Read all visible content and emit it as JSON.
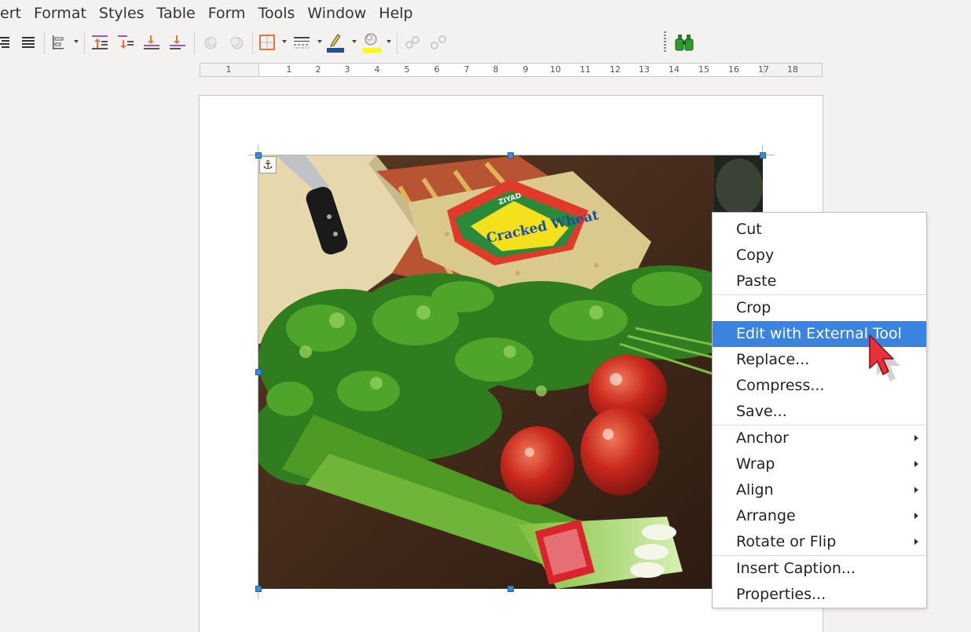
{
  "menubar": {
    "items": [
      "ert",
      "Format",
      "Styles",
      "Table",
      "Form",
      "Tools",
      "Window",
      "Help"
    ]
  },
  "ruler": {
    "numbers": [
      "1",
      "1",
      "2",
      "3",
      "4",
      "5",
      "6",
      "7",
      "8",
      "9",
      "10",
      "11",
      "12",
      "13",
      "14",
      "15",
      "16",
      "17",
      "18"
    ]
  },
  "context_menu": {
    "groups": [
      [
        {
          "label": "Cut"
        },
        {
          "label": "Copy"
        },
        {
          "label": "Paste"
        }
      ],
      [
        {
          "label": "Crop"
        },
        {
          "label": "Edit with External Tool",
          "active": true
        },
        {
          "label": "Replace..."
        },
        {
          "label": "Compress..."
        },
        {
          "label": "Save..."
        }
      ],
      [
        {
          "label": "Anchor",
          "submenu": true
        },
        {
          "label": "Wrap",
          "submenu": true
        },
        {
          "label": "Align",
          "submenu": true
        },
        {
          "label": "Arrange",
          "submenu": true
        },
        {
          "label": "Rotate or Flip",
          "submenu": true
        }
      ],
      [
        {
          "label": "Insert Caption..."
        },
        {
          "label": "Properties..."
        }
      ]
    ]
  },
  "photo": {
    "package_label": "Cracked Wheat",
    "brand": "ZIYAD"
  },
  "colors": {
    "accent": "#3a84e0",
    "cursor": "#e8303a"
  }
}
